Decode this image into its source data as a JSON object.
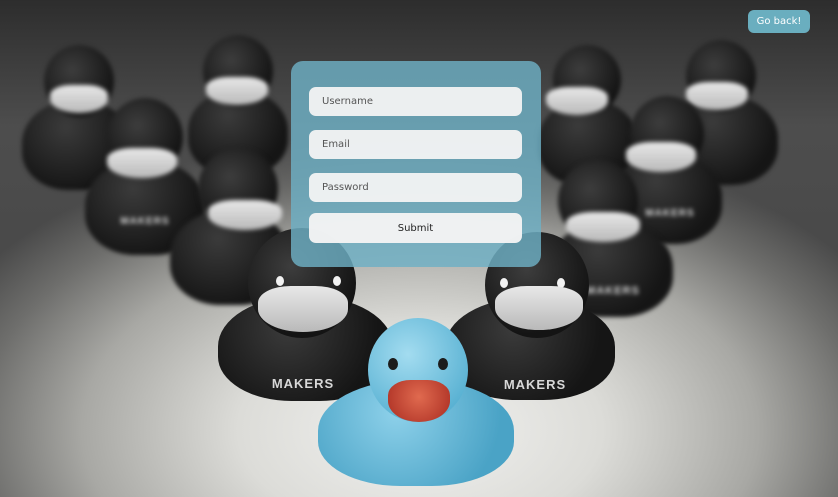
{
  "header": {
    "go_back_label": "Go back!"
  },
  "signup_form": {
    "username_placeholder": "Username",
    "email_placeholder": "Email",
    "password_placeholder": "Password",
    "submit_label": "Submit"
  },
  "background": {
    "brand_text": "MAKERS"
  },
  "colors": {
    "panel": "#6eb0c4",
    "button": "#6aaebf",
    "blue_duck": "#5ab2d3",
    "black_duck": "#1a1a1a"
  }
}
